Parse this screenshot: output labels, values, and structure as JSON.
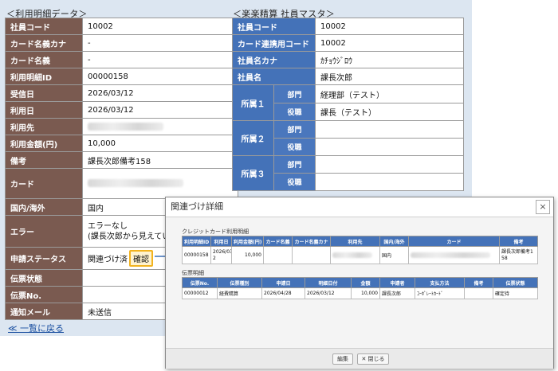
{
  "left_panel": {
    "title": "＜利用明細データ＞",
    "rows": [
      {
        "label": "社員コード",
        "value": "10002"
      },
      {
        "label": "カード名義カナ",
        "value": "-"
      },
      {
        "label": "カード名義",
        "value": "-"
      },
      {
        "label": "利用明細ID",
        "value": "00000158"
      },
      {
        "label": "受信日",
        "value": "2026/03/12"
      },
      {
        "label": "利用日",
        "value": "2026/03/12"
      },
      {
        "label": "利用先",
        "value": ""
      },
      {
        "label": "利用金額(円)",
        "value": "10,000"
      },
      {
        "label": "備考",
        "value": "課長次郎備考158"
      },
      {
        "label": "カード",
        "value": ""
      },
      {
        "label": "国内/海外",
        "value": "国内"
      },
      {
        "label": "エラー",
        "value_line1": "エラーなし",
        "value_line2": "(課長次郎から見えてい"
      },
      {
        "label": "申請ステータス",
        "value": "関連づけ済",
        "button": "確認"
      },
      {
        "label": "伝票状態",
        "value": ""
      },
      {
        "label": "伝票No.",
        "value": ""
      },
      {
        "label": "通知メール",
        "value": "未送信"
      }
    ],
    "back_link": "≪ 一覧に戻る"
  },
  "right_panel": {
    "title": "＜楽楽精算 社員マスタ＞",
    "rows": [
      {
        "label": "社員コード",
        "value": "10002"
      },
      {
        "label": "カード連携用コード",
        "value": "10002"
      },
      {
        "label": "社員名カナ",
        "value": "ｶﾁｮｳｼﾞﾛｳ"
      },
      {
        "label": "社員名",
        "value": "課長次郎"
      }
    ],
    "affiliations": [
      {
        "label": "所属１",
        "dept_label": "部門",
        "dept": "経理部（テスト）",
        "role_label": "役職",
        "role": "課長（テスト）"
      },
      {
        "label": "所属２",
        "dept_label": "部門",
        "dept": "",
        "role_label": "役職",
        "role": ""
      },
      {
        "label": "所属３",
        "dept_label": "部門",
        "dept": "",
        "role_label": "役職",
        "role": ""
      }
    ]
  },
  "modal": {
    "title": "関連づけ詳細",
    "close_label": "×",
    "credit_section": "クレジットカード利用明細",
    "credit_headers": [
      "利用明細ID",
      "利用日",
      "利用金額(円)",
      "カード名義",
      "カード名義カナ",
      "利用先",
      "国内/海外",
      "カード",
      "備考"
    ],
    "credit_row": {
      "id": "00000158",
      "date_l1": "2026/03/1",
      "date_l2": "2",
      "amount": "10,000",
      "name": "",
      "kana": "",
      "shop": "",
      "region": "国内",
      "card": "",
      "note_l1": "課長次郎備考1",
      "note_l2": "58"
    },
    "slip_section": "伝票明細",
    "slip_headers": [
      "伝票No.",
      "伝票種別",
      "申請日",
      "明細日付",
      "金額",
      "申請者",
      "支払方法",
      "備考",
      "伝票状態"
    ],
    "slip_row": {
      "no": "00000012",
      "type": "経費精算",
      "apply_date": "2026/04/28",
      "detail_date": "2026/03/12",
      "amount": "10,000",
      "applicant": "課長次郎",
      "payment": "ｺｰﾎﾟﾚｰﾄｶｰﾄﾞ",
      "note": "",
      "status": "確定待"
    },
    "edit_button": "編集",
    "close_button": "✕ 閉じる"
  },
  "colors": {
    "left_label": "#7a5a50",
    "right_label": "#4472b8",
    "panel_bg": "#dce6f1",
    "highlight": "#f2b31f"
  }
}
